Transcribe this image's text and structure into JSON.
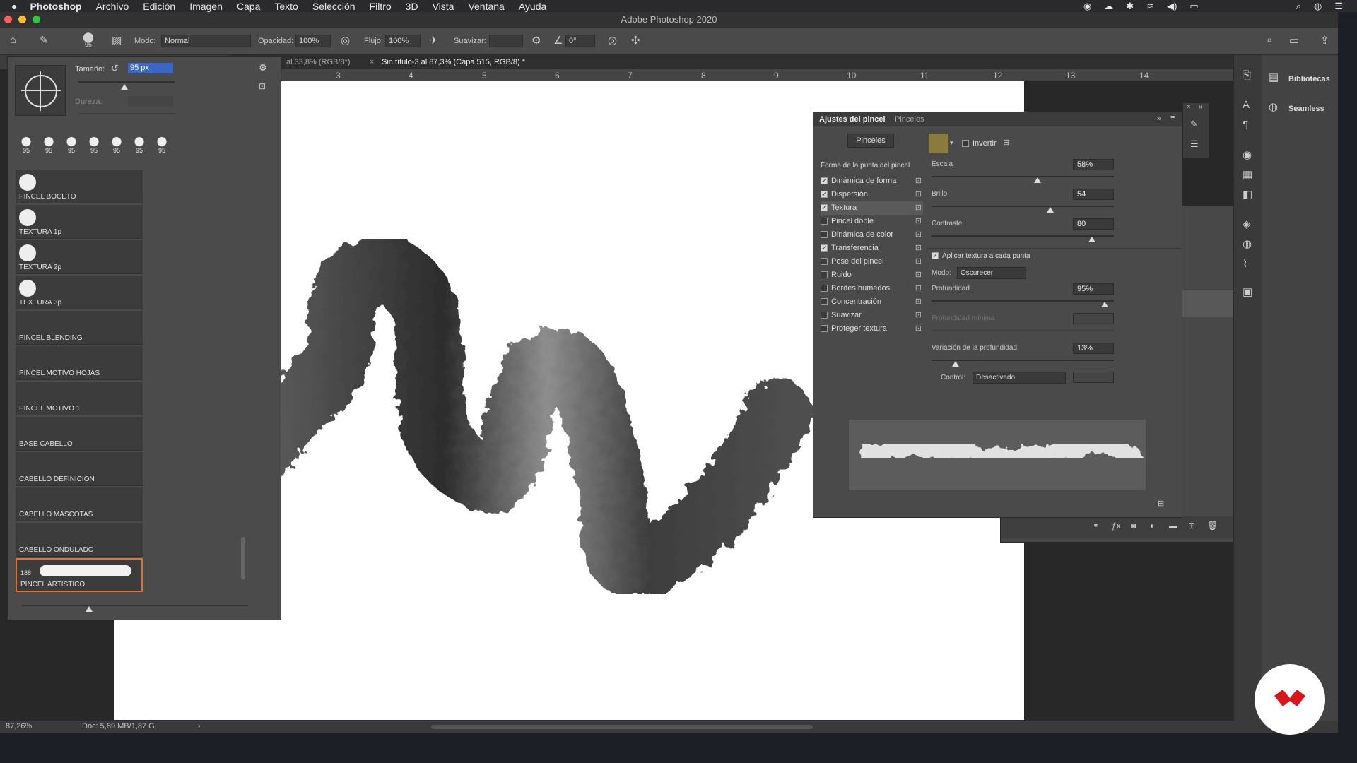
{
  "menubar": {
    "app": "Photoshop",
    "items": [
      "Archivo",
      "Edición",
      "Imagen",
      "Capa",
      "Texto",
      "Selección",
      "Filtro",
      "3D",
      "Vista",
      "Ventana",
      "Ayuda"
    ]
  },
  "window_title": "Adobe Photoshop 2020",
  "options_bar": {
    "brush_size": "95",
    "mode_label": "Modo:",
    "mode_value": "Normal",
    "opacity_label": "Opacidad:",
    "opacity_value": "100%",
    "flow_label": "Flujo:",
    "flow_value": "100%",
    "smooth_label": "Suavizar:",
    "angle_value": "0°"
  },
  "tabs": [
    {
      "label": "al 33,8% (RGB/8*)"
    },
    {
      "label": "Sin título-3 al 87,3% (Capa 515, RGB/8) *"
    }
  ],
  "ruler": [
    "3",
    "4",
    "5",
    "6",
    "7",
    "8",
    "9",
    "10",
    "11",
    "12",
    "13",
    "14"
  ],
  "status": {
    "zoom": "87,26%",
    "doc": "Doc: 5,89 MB/1,87 G"
  },
  "brush_picker": {
    "size_label": "Tamaño:",
    "size_value": "95 px",
    "hardness_label": "Dureza:",
    "presets": [
      "95",
      "95",
      "95",
      "95",
      "95",
      "95",
      "95"
    ],
    "brushes": [
      {
        "name": "PINCEL BOCETO"
      },
      {
        "name": "TEXTURA 1p"
      },
      {
        "name": "TEXTURA 2p"
      },
      {
        "name": "TEXTURA 3p"
      },
      {
        "name": "PINCEL BLENDING"
      },
      {
        "name": "PINCEL MOTIVO HOJAS"
      },
      {
        "name": "PINCEL MOTIVO 1"
      },
      {
        "name": "BASE CABELLO"
      },
      {
        "name": "CABELLO DEFINICION"
      },
      {
        "name": "CABELLO MASCOTAS"
      },
      {
        "name": "CABELLO ONDULADO"
      },
      {
        "name": "PINCEL ARTISTICO",
        "size": "188",
        "selected": true
      }
    ]
  },
  "brush_settings": {
    "tab_active": "Ajustes del pincel",
    "tab_other": "Pinceles",
    "brushes_button": "Pinceles",
    "section_title": "Forma de la punta del pincel",
    "options": [
      {
        "label": "Dinámica de forma",
        "checked": true
      },
      {
        "label": "Dispersión",
        "checked": true
      },
      {
        "label": "Textura",
        "checked": true,
        "active": true
      },
      {
        "label": "Pincel doble",
        "checked": false
      },
      {
        "label": "Dinámica de color",
        "checked": false
      },
      {
        "label": "Transferencia",
        "checked": true
      },
      {
        "label": "Pose del pincel",
        "checked": false
      },
      {
        "label": "Ruido",
        "checked": false
      },
      {
        "label": "Bordes húmedos",
        "checked": false
      },
      {
        "label": "Concentración",
        "checked": false
      },
      {
        "label": "Suavizar",
        "checked": false
      },
      {
        "label": "Proteger textura",
        "checked": false
      }
    ],
    "invert_label": "Invertir",
    "scale_label": "Escala",
    "scale_value": "58%",
    "scale_frac": 0.58,
    "brightness_label": "Brillo",
    "brightness_value": "54",
    "brightness_frac": 0.65,
    "contrast_label": "Contraste",
    "contrast_value": "80",
    "contrast_frac": 0.88,
    "apply_texture_label": "Aplicar textura a cada punta",
    "mode_label": "Modo:",
    "mode_value": "Oscurecer",
    "depth_label": "Profundidad",
    "depth_value": "95%",
    "depth_frac": 0.95,
    "min_depth_label": "Profundidad mínima",
    "depth_var_label": "Variación de la profundidad",
    "depth_var_value": "13%",
    "depth_var_frac": 0.13,
    "control_label": "Control:",
    "control_value": "Desactivado"
  },
  "libraries": {
    "title": "Bibliotecas",
    "item": "Seamless"
  },
  "colors": {
    "accent": "#e8702a",
    "logo": "#d9161c"
  }
}
